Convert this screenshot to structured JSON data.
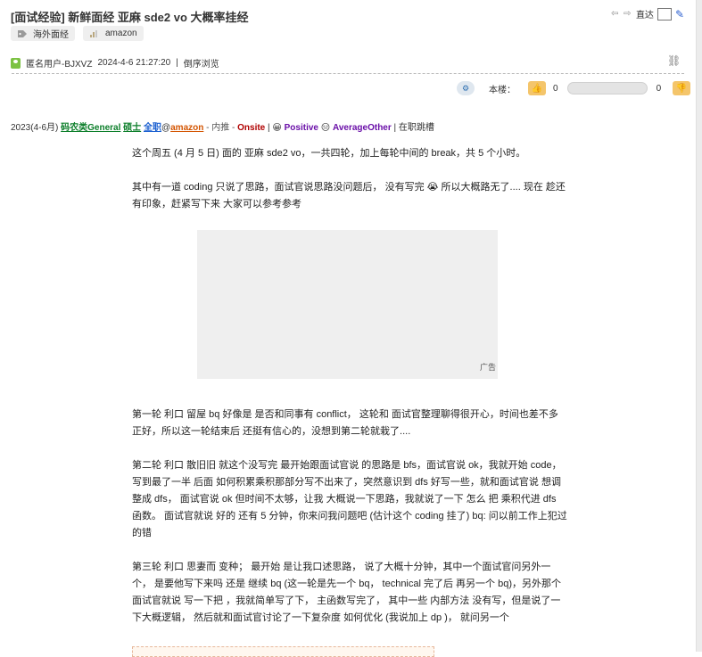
{
  "thread": {
    "title": "[面试经验] 新鲜面经 亚麻 sde2 vo 大概率挂经",
    "tags": [
      "海外面经",
      "amazon"
    ]
  },
  "nav": {
    "jump_label": "直达"
  },
  "meta": {
    "author": "匿名用户-BJXVZ",
    "datetime": "2024-4-6 21:27:20",
    "separator": "|",
    "reverse_view": "倒序浏览"
  },
  "vote": {
    "floor_label": "本楼：",
    "up_count": "0",
    "down_count": "0"
  },
  "summary": {
    "date": "2023(4-6月)",
    "category": "码农类General",
    "degree": "硕士",
    "job_type": "全职",
    "at": "@",
    "company": "amazon",
    "referral": "- 内推 - ",
    "stage": "Onsite",
    "sep1": " | ",
    "result": "Positive",
    "difficulty": "AverageOther",
    "sep2": " | ",
    "status": "在职跳槽"
  },
  "content": {
    "p1": "这个周五 (4 月 5 日) 面的 亚麻 sde2  vo，一共四轮，加上每轮中间的 break，共 5 个小时。",
    "p2": "其中有一道 coding 只说了思路，面试官说思路没问题后， 没有写完 😭  所以大概路无了.... 现在 趁还有印象，赶紧写下来  大家可以参考参考",
    "ad_label": "广告",
    "p3": "第一轮    利口 留屋     bq  好像是 是否和同事有 conflict，  这轮和 面试官整理聊得很开心，时间也差不多正好，所以这一轮结束后 还挺有信心的，没想到第二轮就栽了....",
    "p4": "第二轮    利口  散旧旧  就这个没写完   最开始跟面试官说 的思路是 bfs，面试官说 ok，我就开始 code，写到最了一半 后面 如何积累乘积那部分写不出来了，突然意识到 dfs 好写一些，就和面试官说 想调整成  dfs，  面试官说  ok 但时间不太够，让我 大概说一下思路，我就说了一下 怎么 把 乘积代进 dfs 函数。 面试官就说 好的 还有 5 分钟，你来问我问题吧  (估计这个 coding 挂了)       bq: 问以前工作上犯过的错",
    "p5": "第三轮   利口  思妻而  变种；  最开始 是让我口述思路，  说了大概十分钟，其中一个面试官问另外一个，  是要他写下来吗 还是 继续 bq (这一轮是先一个 bq，  technical 完了后 再另一个 bq)，另外那个面试官就说  写一下把 ，我就简单写了下，  主函数写完了，  其中一些  内部方法 没有写，但是说了一下大概逻辑，  然后就和面试官讨论了一下复杂度  如何优化 (我说加上 dp )，  就问另一个"
  }
}
